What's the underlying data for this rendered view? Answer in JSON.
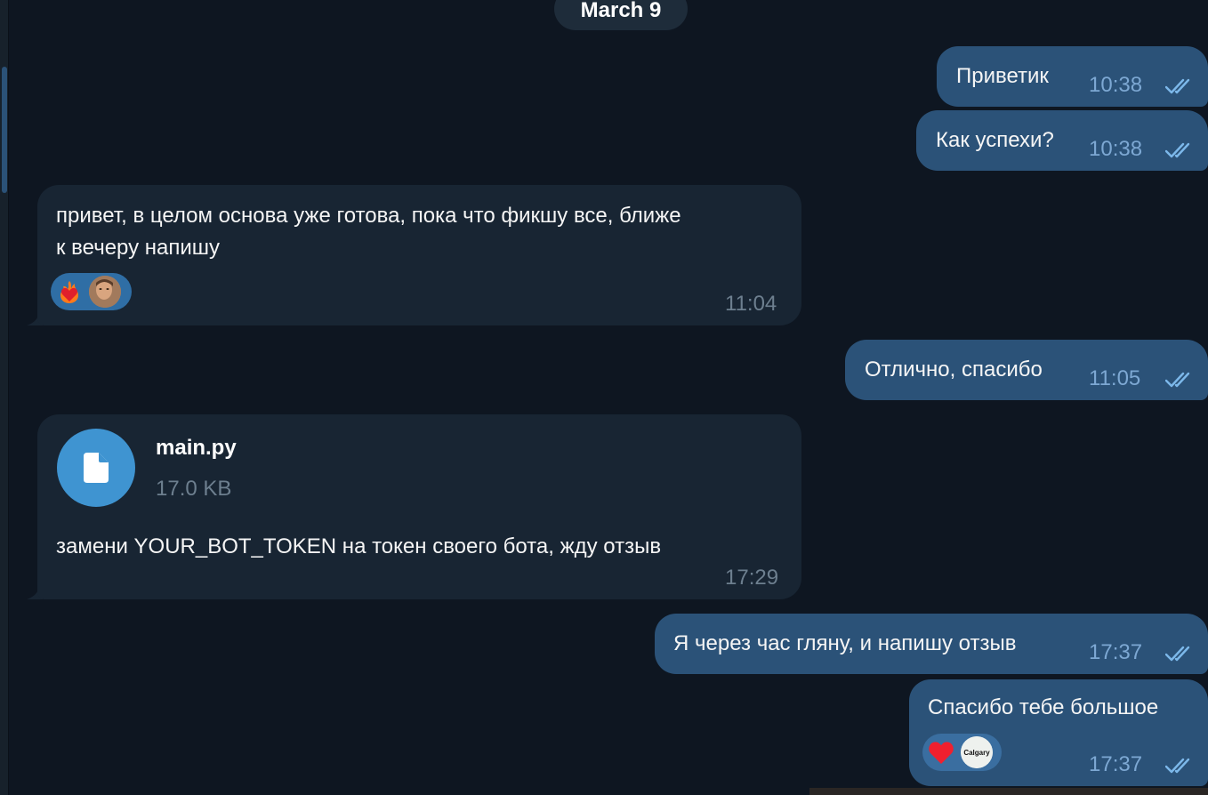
{
  "date_divider": "March 9",
  "messages": [
    {
      "direction": "out",
      "text": "Приветик",
      "time": "10:38"
    },
    {
      "direction": "out",
      "text": "Как успехи?",
      "time": "10:38"
    },
    {
      "direction": "in",
      "text_line1": "привет, в целом основа уже готова, пока что фикшу все, ближе",
      "text_line2": "к вечеру напишу",
      "time": "11:04",
      "reactions": [
        "heart-on-fire",
        "user-avatar"
      ]
    },
    {
      "direction": "out",
      "text": "Отлично, спасибо",
      "time": "11:05"
    },
    {
      "direction": "in",
      "file_name": "main.py",
      "file_size": "17.0 KB",
      "caption": "замени YOUR_BOT_TOKEN на токен своего бота, жду отзыв",
      "time": "17:29"
    },
    {
      "direction": "out",
      "text": "Я через час гляну, и напишу отзыв",
      "time": "17:37"
    },
    {
      "direction": "out",
      "text": "Спасибо тебе большое",
      "time": "17:37",
      "reactions": [
        "red-heart",
        "user-avatar"
      ],
      "avatar_caption": "Calgary"
    }
  ],
  "colors": {
    "background": "#0e1621",
    "incoming_bubble": "#182533",
    "outgoing_bubble": "#2b5278",
    "read_check": "#7cb8ea",
    "file_icon": "#3f94d1"
  }
}
